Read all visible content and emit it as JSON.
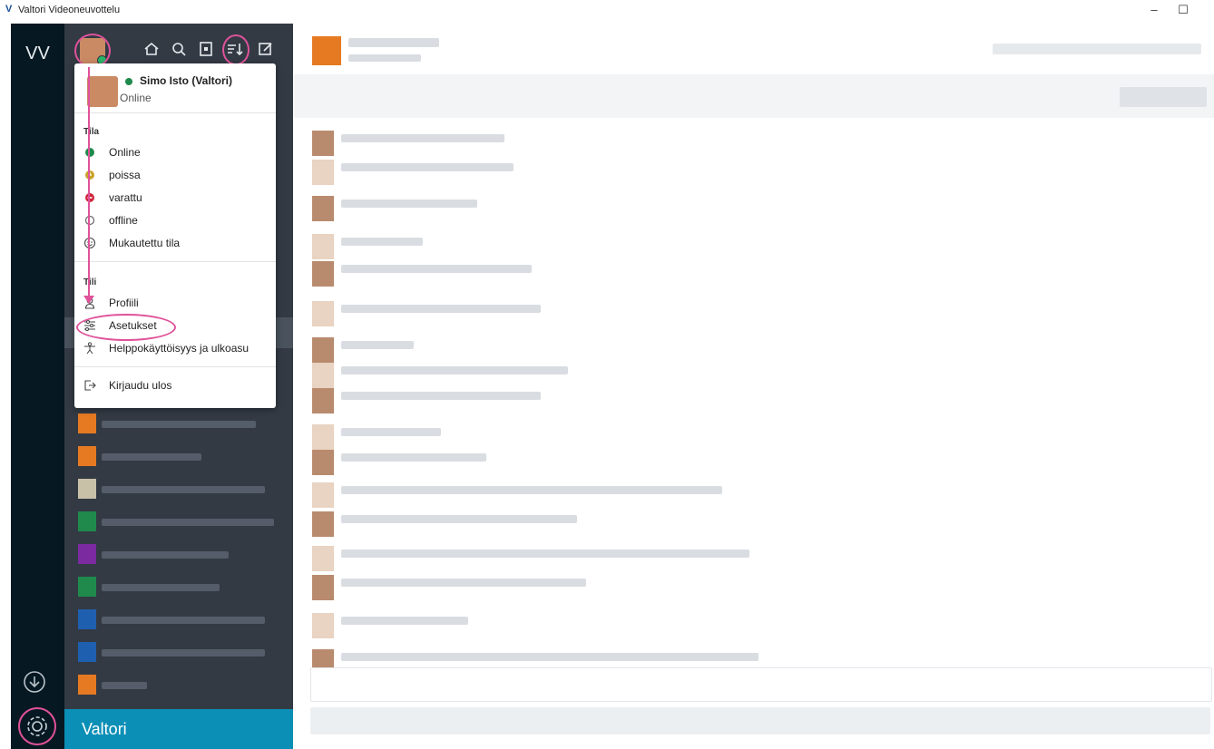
{
  "window": {
    "title": "Valtori Videoneuvottelu",
    "app_icon": "V",
    "minimize": "–",
    "maximize": "☐"
  },
  "rail": {
    "workspace": "VV"
  },
  "brand": {
    "label": "Valtori"
  },
  "profile_menu": {
    "name": "Simo Isto (Valtori)",
    "status": "Online",
    "status_section": "Tila",
    "status_items": [
      {
        "label": "Online",
        "color": "#1f8a4c"
      },
      {
        "label": "poissa",
        "color": "#c9a227"
      },
      {
        "label": "varattu",
        "color": "#d0263a"
      },
      {
        "label": "offline",
        "color": "#666666"
      },
      {
        "label": "Mukautettu tila"
      }
    ],
    "account_section": "Tili",
    "account_items": [
      {
        "label": "Profiili",
        "icon": "profile-icon"
      },
      {
        "label": "Asetukset",
        "icon": "settings-sliders-icon"
      },
      {
        "label": "Helppokäyttöisyys ja ulkoasu",
        "icon": "accessibility-icon"
      }
    ],
    "logout": "Kirjaudu ulos"
  },
  "colors": {
    "highlight": "#e0529a",
    "rail": "#061821",
    "sidebar": "#333a44",
    "brand": "#0c8fb6"
  }
}
